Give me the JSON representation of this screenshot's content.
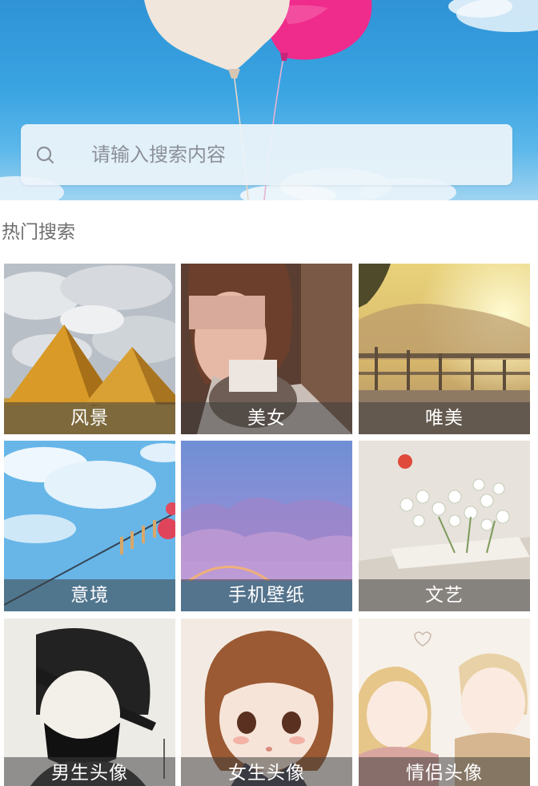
{
  "search": {
    "placeholder": "请输入搜索内容",
    "icon": "search-icon"
  },
  "hot_search": {
    "title": "热门搜索"
  },
  "categories": [
    {
      "label": "风景",
      "thumb": "pyramids-image"
    },
    {
      "label": "美女",
      "thumb": "girl-portrait-image"
    },
    {
      "label": "唯美",
      "thumb": "sunset-bridge-image"
    },
    {
      "label": "意境",
      "thumb": "sky-clothesline-image"
    },
    {
      "label": "手机壁纸",
      "thumb": "purple-landscape-image"
    },
    {
      "label": "文艺",
      "thumb": "flowers-book-image"
    },
    {
      "label": "男生头像",
      "thumb": "boy-avatar-image"
    },
    {
      "label": "女生头像",
      "thumb": "girl-avatar-image"
    },
    {
      "label": "情侣头像",
      "thumb": "couple-avatar-image"
    }
  ],
  "colors": {
    "hero_sky": "#3aa4e2",
    "caption_bg": "#3c3c3c",
    "search_bg": "#ecf4fa",
    "placeholder_text": "#8c9098",
    "section_title_text": "#6e6e6e"
  }
}
